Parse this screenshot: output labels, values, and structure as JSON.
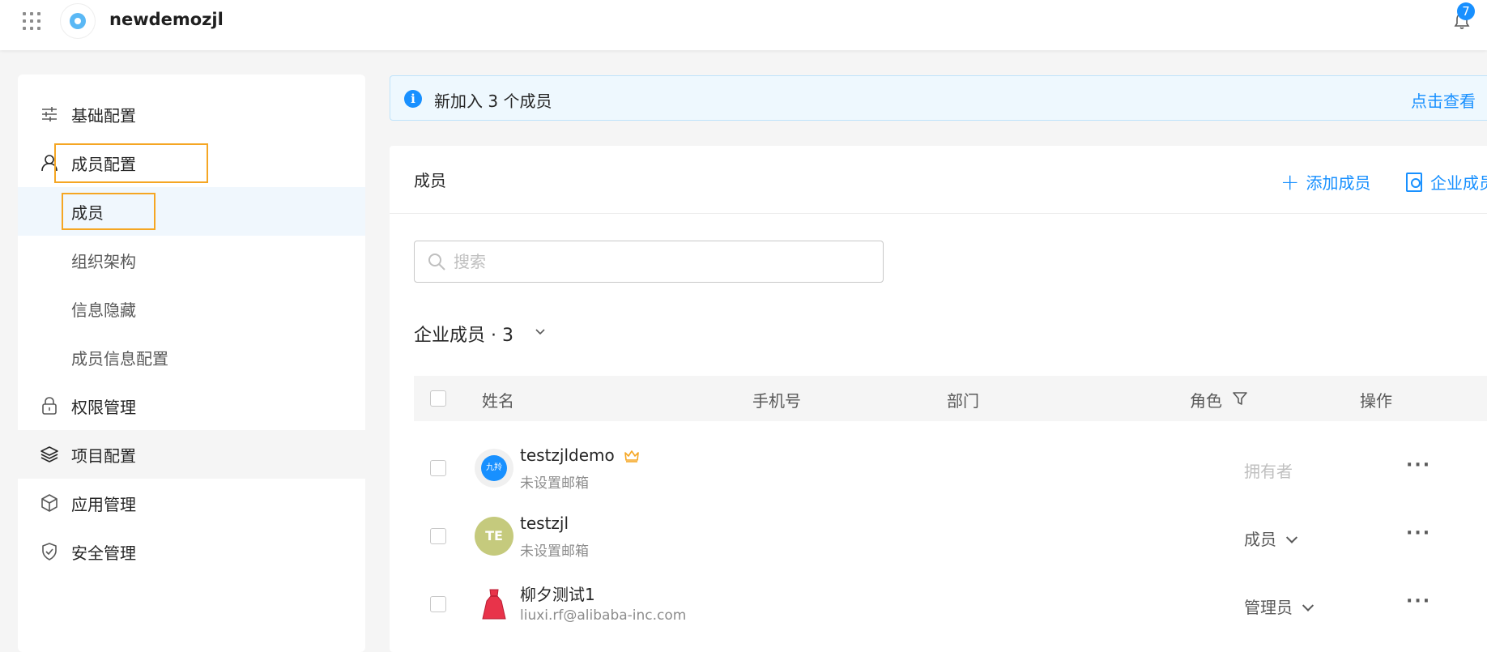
{
  "topbar": {
    "org_name": "newdemozjl",
    "notification_count": "7"
  },
  "sidebar": {
    "items": [
      {
        "label": "基础配置",
        "icon": "sliders-icon"
      },
      {
        "label": "成员配置",
        "icon": "user-icon"
      },
      {
        "label": "成员"
      },
      {
        "label": "组织架构"
      },
      {
        "label": "信息隐藏"
      },
      {
        "label": "成员信息配置"
      },
      {
        "label": "权限管理",
        "icon": "lock-icon"
      },
      {
        "label": "项目配置",
        "icon": "layers-icon"
      },
      {
        "label": "应用管理",
        "icon": "cube-icon"
      },
      {
        "label": "安全管理",
        "icon": "shield-check-icon"
      }
    ]
  },
  "notice": {
    "text": "新加入 3 个成员",
    "link": "点击查看"
  },
  "panel": {
    "title": "成员",
    "add_member": "添加成员",
    "enterprise_btn": "企业成员"
  },
  "search": {
    "placeholder": "搜索",
    "value": ""
  },
  "group": {
    "title": "企业成员 · 3"
  },
  "table": {
    "headers": {
      "name": "姓名",
      "phone": "手机号",
      "dept": "部门",
      "role": "角色",
      "action": "操作"
    },
    "rows": [
      {
        "name": "testzjldemo",
        "email": "未设置邮箱",
        "role": "拥有者",
        "avatar_text": "九羚",
        "avatar_color": "#1890ff"
      },
      {
        "name": "testzjl",
        "email": "未设置邮箱",
        "role": "成员",
        "avatar_text": "TE",
        "avatar_color": "#c5ca7d"
      },
      {
        "name": "柳夕测试1",
        "email": "liuxi.rf@alibaba-inc.com",
        "role": "管理员"
      }
    ],
    "more": "···"
  }
}
